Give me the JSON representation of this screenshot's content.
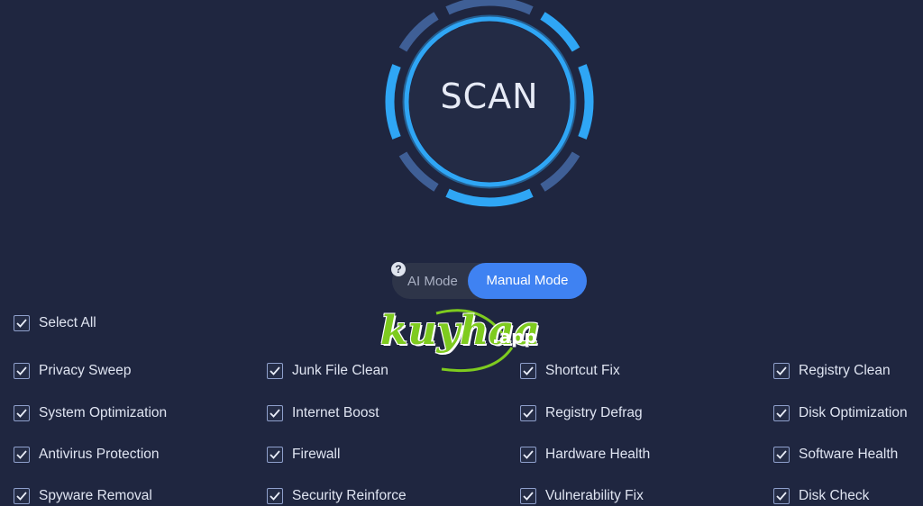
{
  "scan": {
    "label": "SCAN"
  },
  "mode": {
    "help_glyph": "?",
    "ai_label": "AI Mode",
    "manual_label": "Manual Mode",
    "selected": "Manual Mode"
  },
  "select_all": {
    "label": "Select All",
    "checked": true
  },
  "options": [
    {
      "label": "Privacy Sweep",
      "checked": true
    },
    {
      "label": "Junk File Clean",
      "checked": true
    },
    {
      "label": "Shortcut Fix",
      "checked": true
    },
    {
      "label": "Registry Clean",
      "checked": true
    },
    {
      "label": "System Optimization",
      "checked": true
    },
    {
      "label": "Internet Boost",
      "checked": true
    },
    {
      "label": "Registry Defrag",
      "checked": true
    },
    {
      "label": "Disk Optimization",
      "checked": true
    },
    {
      "label": "Antivirus Protection",
      "checked": true
    },
    {
      "label": "Firewall",
      "checked": true
    },
    {
      "label": "Hardware Health",
      "checked": true
    },
    {
      "label": "Software Health",
      "checked": true
    },
    {
      "label": "Spyware Removal",
      "checked": true
    },
    {
      "label": "Security Reinforce",
      "checked": true
    },
    {
      "label": "Vulnerability Fix",
      "checked": true
    },
    {
      "label": "Disk Check",
      "checked": true
    }
  ],
  "watermark": {
    "main": "kuyhaa",
    "suffix": ".app"
  },
  "colors": {
    "background": "#1f2640",
    "ring_accent": "#2fa6f5",
    "ring_dim": "#3f5f96",
    "manual_mode_active": "#3f82f2",
    "checkbox_border": "#8fa0cc",
    "watermark_green": "#7ecb1f"
  },
  "icons": {
    "checkbox": "checkmark-icon",
    "help": "question-circle-icon"
  }
}
